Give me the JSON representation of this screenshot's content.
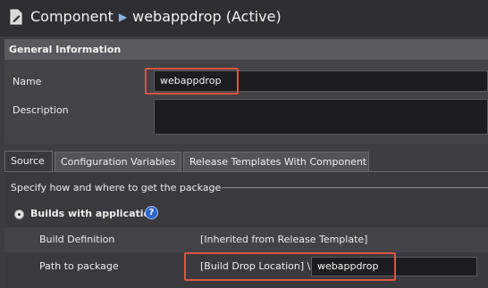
{
  "title": {
    "component": "Component",
    "name": "webappdrop (Active)"
  },
  "general": {
    "header": "General Information",
    "name_label": "Name",
    "name_value": "webappdrop",
    "description_label": "Description",
    "description_value": ""
  },
  "tabs": [
    {
      "label": "Source"
    },
    {
      "label": "Configuration Variables"
    },
    {
      "label": "Release Templates With Component"
    }
  ],
  "source": {
    "heading": "Specify how and where to get the package",
    "option_label": "Builds with application",
    "help_glyph": "?",
    "build_definition_label": "Build Definition",
    "build_definition_value": "[Inherited from Release Template]",
    "path_label": "Path to package",
    "path_prefix": "[Build Drop Location] \\",
    "path_value": "webappdrop"
  },
  "colors": {
    "highlight": "#e0533f",
    "accent": "#8fb4e6"
  }
}
